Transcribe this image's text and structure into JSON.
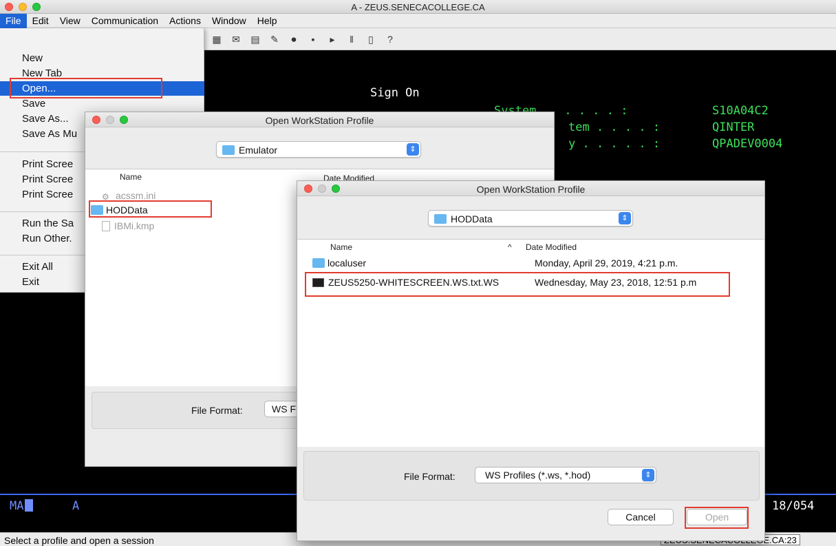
{
  "window": {
    "title": "A - ZEUS.SENECACOLLEGE.CA"
  },
  "menubar": [
    "File",
    "Edit",
    "View",
    "Communication",
    "Actions",
    "Window",
    "Help"
  ],
  "file_menu": {
    "items": [
      "New",
      "New Tab",
      "Open...",
      "Save",
      "Save As...",
      "Save As Mu",
      "Print Scree",
      "Print Scree",
      "Print Scree",
      "Run the Sa",
      "Run Other.",
      "Exit All",
      "Exit"
    ]
  },
  "terminal": {
    "sign_on": "Sign On",
    "fields": [
      {
        "label": "System  . . . . . :",
        "value": "S10A04C2"
      },
      {
        "label": "tem . . . . :",
        "value": "QINTER"
      },
      {
        "label": "y . . . . . :",
        "value": "QPADEV0004"
      }
    ],
    "oia_left": "MA",
    "oia_a": "A",
    "cursor_pos": "18/054"
  },
  "status_bar": {
    "message": "Select a profile and open a session",
    "host": "ZEUS.SENECACOLLEGE.CA:23"
  },
  "dialog_back": {
    "title": "Open WorkStation Profile",
    "folder": "Emulator",
    "col_name": "Name",
    "col_date": "Date Modified",
    "files": [
      "acssm.ini",
      "HODData",
      "IBMi.kmp"
    ],
    "file_format_label": "File Format:",
    "file_format_value": "WS F"
  },
  "dialog_front": {
    "title": "Open WorkStation Profile",
    "folder": "HODData",
    "col_name": "Name",
    "col_date": "Date Modified",
    "files": [
      {
        "name": "localuser",
        "date": "Monday, April 29, 2019, 4:21 p.m."
      },
      {
        "name": "ZEUS5250-WHITESCREEN.WS.txt.WS",
        "date": "Wednesday, May 23, 2018, 12:51 p.m"
      }
    ],
    "file_format_label": "File Format:",
    "file_format_value": "WS Profiles (*.ws, *.hod)",
    "cancel_label": "Cancel",
    "open_label": "Open"
  }
}
